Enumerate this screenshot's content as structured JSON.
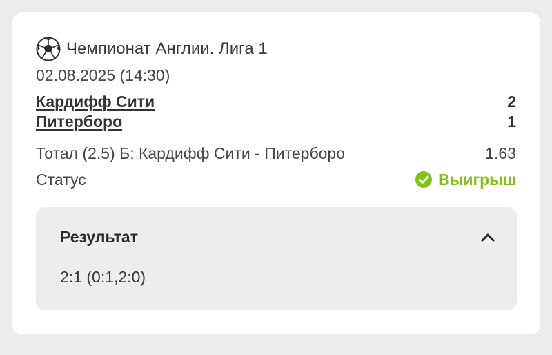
{
  "header": {
    "icon": "soccer-ball-icon",
    "league": "Чемпионат Англии. Лига 1",
    "datetime": "02.08.2025 (14:30)"
  },
  "match": {
    "home": {
      "name": "Кардифф Сити",
      "score": "2"
    },
    "away": {
      "name": "Питерборо",
      "score": "1"
    }
  },
  "bet": {
    "market": "Тотал (2.5) Б: Кардифф Сити - Питерборо",
    "odds": "1.63",
    "status_label": "Статус",
    "status_value": "Выигрыш",
    "status_icon": "check-circle-icon",
    "status_color": "#82c01b"
  },
  "result": {
    "title": "Результат",
    "toggle_icon": "chevron-up-icon",
    "score": "2:1 (0:1,2:0)"
  }
}
